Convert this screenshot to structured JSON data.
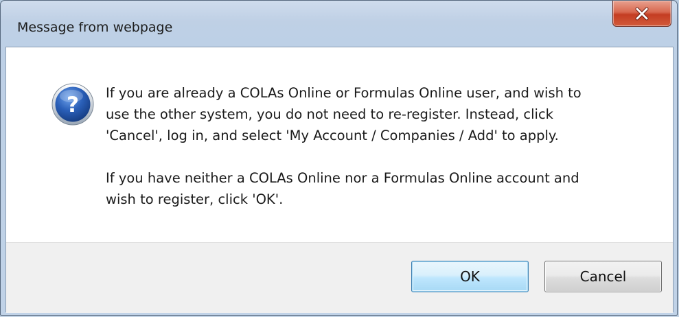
{
  "dialog": {
    "title": "Message from webpage",
    "close_icon": "close-icon",
    "message_icon": "question-icon",
    "paragraphs": [
      "If you are already a COLAs Online or Formulas Online user, and wish to\nuse the other system, you do not need to re-register. Instead, click\n'Cancel', log in, and select 'My Account / Companies / Add' to apply.",
      "If you have neither a COLAs Online nor a Formulas Online account and\nwish to register, click 'OK'."
    ],
    "buttons": {
      "ok_label": "OK",
      "cancel_label": "Cancel"
    }
  },
  "colors": {
    "close_button": "#c43d22",
    "ok_button_border": "#3c7fb1",
    "icon_blue": "#1d4fa5"
  }
}
